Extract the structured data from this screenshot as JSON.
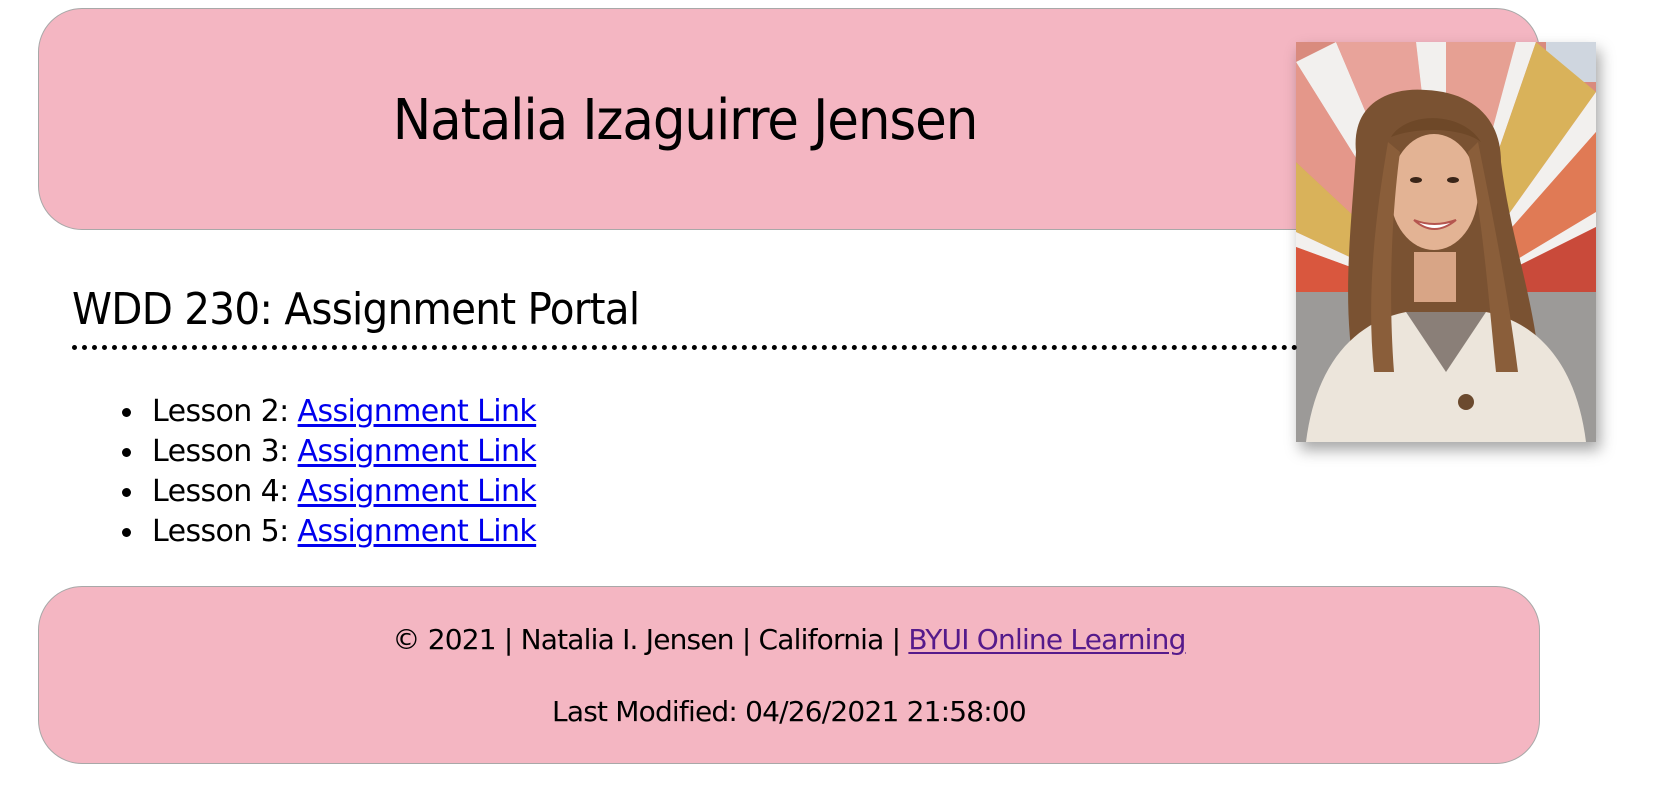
{
  "header": {
    "title": "Natalia Izaguirre Jensen",
    "portrait_alt": "portrait photo of Natalia Izaguirre Jensen"
  },
  "main": {
    "heading": "WDD 230: Assignment Portal",
    "lessons": [
      {
        "label": "Lesson 2: ",
        "link_text": "Assignment Link"
      },
      {
        "label": "Lesson 3: ",
        "link_text": "Assignment Link"
      },
      {
        "label": "Lesson 4: ",
        "link_text": "Assignment Link"
      },
      {
        "label": "Lesson 5: ",
        "link_text": "Assignment Link"
      }
    ]
  },
  "footer": {
    "copyright_text": "© 2021 | Natalia I. Jensen | California | ",
    "online_learning_link": "BYUI Online Learning",
    "last_modified_label": "Last Modified: ",
    "last_modified_value": "04/26/2021 21:58:00"
  },
  "colors": {
    "panel_background": "#f4b6c2",
    "link": "#0000ee",
    "visited_link": "#551a8b"
  }
}
